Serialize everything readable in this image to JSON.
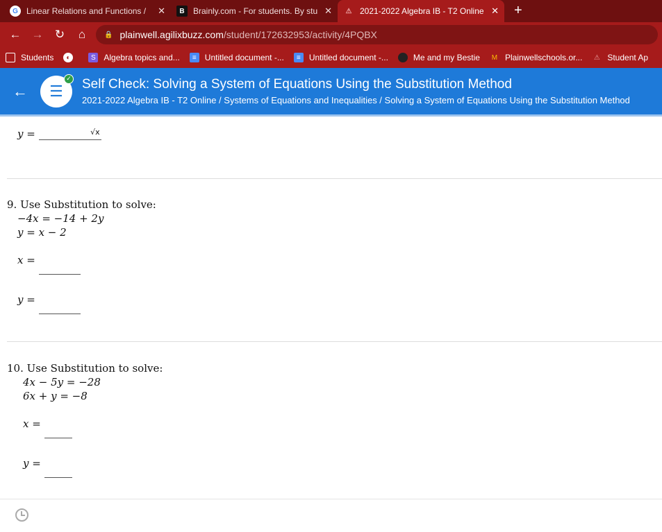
{
  "tabs": [
    {
      "title": "Linear Relations and Functions /",
      "icon": "google-icon"
    },
    {
      "title": "Brainly.com - For students. By stu",
      "icon": "brainly-icon"
    },
    {
      "title": "2021-2022 Algebra IB - T2 Online",
      "icon": "agilix-icon",
      "active": true
    }
  ],
  "url": {
    "host": "plainwell.agilixbuzz.com",
    "path": "/student/172632953/activity/4PQBX"
  },
  "bookmarks": [
    "Students",
    "",
    "Algebra topics and...",
    "Untitled document -...",
    "Untitled document -...",
    "Me and my Bestie",
    "Plainwellschools.or...",
    "Student Ap"
  ],
  "header": {
    "title": "Self Check: Solving a System of Equations Using the Substitution Method",
    "breadcrumb": "2021-2022 Algebra IB - T2 Online / Systems of Equations and Inequalities / Solving a System of Equations Using the Substitution Method"
  },
  "q8": {
    "y_label": "y =",
    "sqrt": "√x"
  },
  "q9": {
    "prompt": "9. Use Substitution to solve:",
    "eq1": "−4x = −14 + 2y",
    "eq2": "y = x − 2",
    "x_label": "x =",
    "y_label": "y ="
  },
  "q10": {
    "prompt": "10. Use Substitution to solve:",
    "eq1": "4x − 5y = −28",
    "eq2": "6x + y = −8",
    "x_label": "x =",
    "y_label": "y ="
  },
  "colors": {
    "browser": "#a61b1b",
    "header": "#1e7ad9"
  }
}
